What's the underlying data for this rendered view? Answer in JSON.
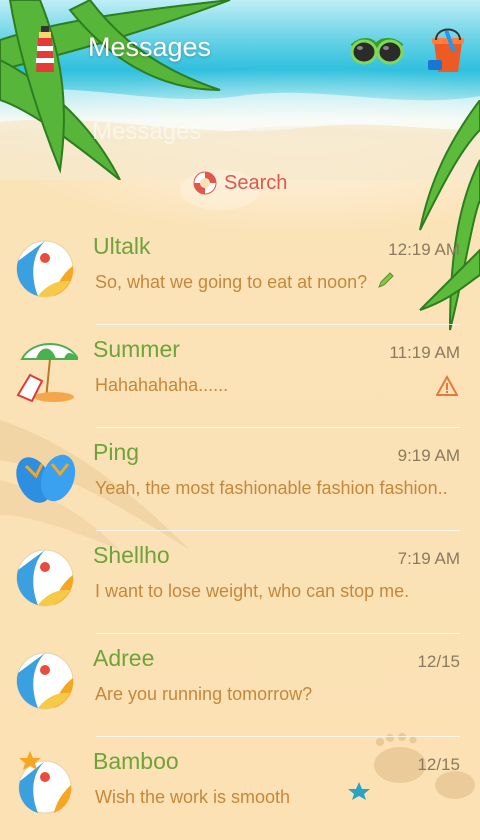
{
  "header": {
    "title": "Messages",
    "ghost_title": "Messages",
    "icons": [
      "lighthouse-icon",
      "goggles-icon",
      "sand-bucket-icon"
    ]
  },
  "search": {
    "label": "Search",
    "icon": "life-ring-icon"
  },
  "colors": {
    "name": "#6fa33a",
    "snippet": "#c5883a",
    "search": "#e2574c"
  },
  "conversations": [
    {
      "name": "Ultalk",
      "time": "12:19 AM",
      "snippet": "So, what we going to eat at noon?",
      "avatar": "beach-ball",
      "status": "draft-pencil-icon"
    },
    {
      "name": "Summer",
      "time": "11:19 AM",
      "snippet": "Hahahahaha......",
      "avatar": "beach-umbrella",
      "status": "warning-icon"
    },
    {
      "name": "Ping",
      "time": "9:19 AM",
      "snippet": "Yeah, the most fashionable fashion fashion..",
      "avatar": "flip-flops",
      "status": ""
    },
    {
      "name": "Shellho",
      "time": "7:19 AM",
      "snippet": "I want to lose weight, who can stop me.",
      "avatar": "beach-ball",
      "status": ""
    },
    {
      "name": "Adree",
      "time": "12/15",
      "snippet": "Are you running tomorrow?",
      "avatar": "beach-ball",
      "status": ""
    },
    {
      "name": "Bamboo",
      "time": "12/15",
      "snippet": "Wish the work is smooth",
      "avatar": "beach-ball-starfish",
      "status": ""
    }
  ]
}
